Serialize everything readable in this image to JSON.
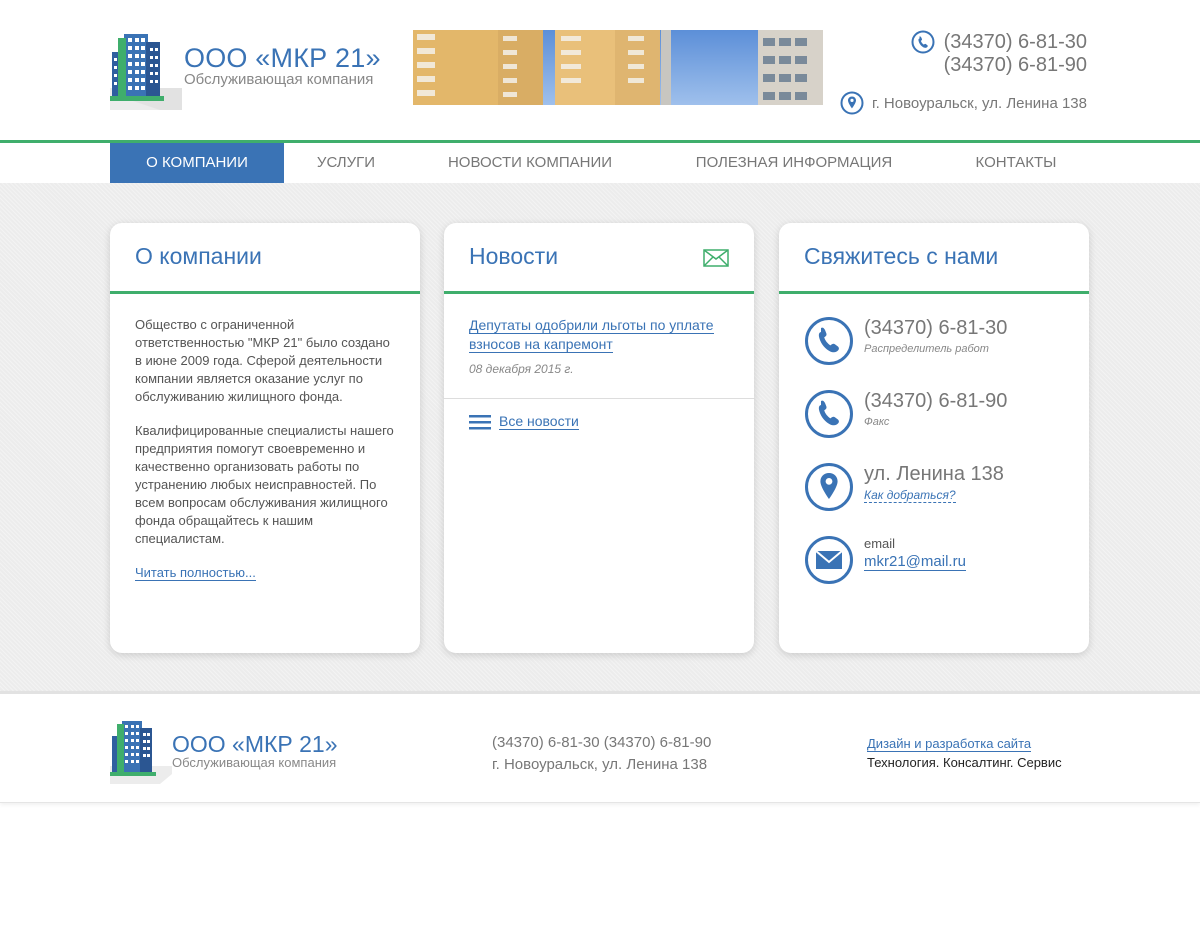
{
  "header": {
    "logo_title": "ООО «МКР 21»",
    "logo_sub": "Обслуживающая компания",
    "phone1": "(34370) 6-81-30",
    "phone2": "(34370) 6-81-90",
    "address": "г. Новоуральск, ул. Ленина 138"
  },
  "nav": {
    "items": [
      {
        "label": "О компании"
      },
      {
        "label": "Услуги"
      },
      {
        "label": "Новости компании"
      },
      {
        "label": "Полезная информация"
      },
      {
        "label": "Контакты"
      }
    ]
  },
  "about": {
    "title": "О компании",
    "p1": "Общество с ограниченной ответственностью \"МКР 21\" было создано в июне 2009 года. Сферой деятельности компании является оказание услуг по обслуживанию жилищного фонда.",
    "p2": "Квалифицированные специалисты нашего предприятия помогут своевременно и качественно организовать работы по устранению любых неисправностей. По всем вопросам обслуживания жилищного фонда обращайтесь к нашим специалистам.",
    "read_more": "Читать полностью..."
  },
  "news": {
    "title": "Новости",
    "item_title": "Депутаты одобрили льготы по уплате взносов на капремонт",
    "item_date": "08 декабря 2015 г.",
    "all_news": "Все новости"
  },
  "contact": {
    "title": "Свяжитесь с нами",
    "phone1": "(34370) 6-81-30",
    "phone1_note": "Распределитель работ",
    "phone2": "(34370) 6-81-90",
    "phone2_note": "Факс",
    "street": "ул. Ленина 138",
    "directions": "Как добраться?",
    "email_label": "email",
    "email": "mkr21@mail.ru"
  },
  "footer": {
    "logo_title": "ООО «МКР 21»",
    "logo_sub": "Обслуживающая компания",
    "phones": "(34370) 6-81-30 (34370) 6-81-90",
    "address": "г. Новоуральск, ул. Ленина 138",
    "dev_link": "Дизайн и разработка сайта",
    "dev_name": "Технология. Консалтинг. Сервис"
  },
  "colors": {
    "brand_blue": "#3a73b5",
    "accent_green": "#3fae6c"
  }
}
